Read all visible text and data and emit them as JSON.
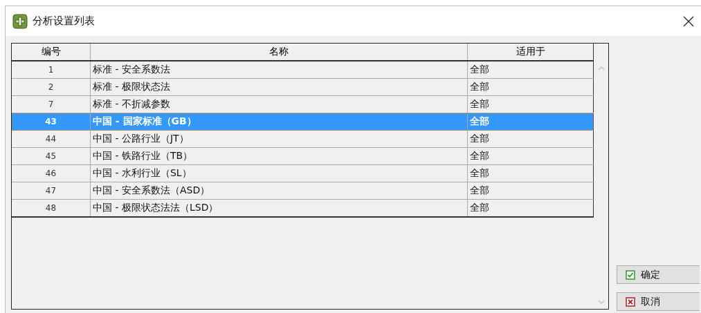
{
  "window": {
    "title": "分析设置列表"
  },
  "table": {
    "columns": [
      "编号",
      "名称",
      "适用于"
    ],
    "rows": [
      {
        "cells": [
          "1",
          "标准 - 安全系数法",
          "全部"
        ],
        "selected": false
      },
      {
        "cells": [
          "2",
          "标准 - 极限状态法",
          "全部"
        ],
        "selected": false
      },
      {
        "cells": [
          "7",
          "标准 - 不折减参数",
          "全部"
        ],
        "selected": false
      },
      {
        "cells": [
          "43",
          "中国 - 国家标准（GB）",
          "全部"
        ],
        "selected": true
      },
      {
        "cells": [
          "44",
          "中国 - 公路行业（JT）",
          "全部"
        ],
        "selected": false
      },
      {
        "cells": [
          "45",
          "中国 - 铁路行业（TB）",
          "全部"
        ],
        "selected": false
      },
      {
        "cells": [
          "46",
          "中国 - 水利行业（SL）",
          "全部"
        ],
        "selected": false
      },
      {
        "cells": [
          "47",
          "中国 - 安全系数法（ASD）",
          "全部"
        ],
        "selected": false
      },
      {
        "cells": [
          "48",
          "中国 - 极限状态法法（LSD）",
          "全部"
        ],
        "selected": false
      }
    ]
  },
  "buttons": [
    {
      "kind": "ok",
      "label": "确定"
    },
    {
      "kind": "cancel",
      "label": "取消"
    }
  ]
}
